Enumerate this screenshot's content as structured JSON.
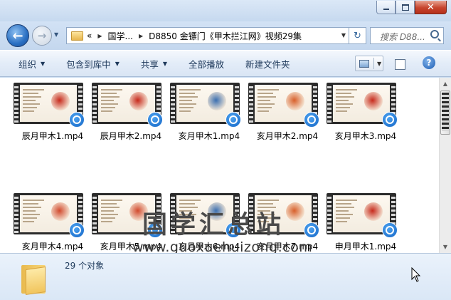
{
  "nav": {
    "back_glyph": "←",
    "forward_glyph": "→",
    "history_glyph": "▼",
    "address": {
      "prefix": "«",
      "segments": [
        "国学...",
        "D8850 金镖门《甲木拦江网》视频29集"
      ]
    },
    "refresh_glyph": "↻",
    "search_placeholder": "搜索 D88..."
  },
  "commands": {
    "organize": "组织",
    "include_in_library": "包含到库中",
    "share": "共享",
    "play_all": "全部播放",
    "new_folder": "新建文件夹",
    "help": "?"
  },
  "files": [
    {
      "name": "辰月甲木1.mp4",
      "accent": "#c72a1c"
    },
    {
      "name": "辰月甲木2.mp4",
      "accent": "#c72a1c"
    },
    {
      "name": "亥月甲木1.mp4",
      "accent": "#3b6fb0"
    },
    {
      "name": "亥月甲木2.mp4",
      "accent": "#d8602b"
    },
    {
      "name": "亥月甲木3.mp4",
      "accent": "#c72a1c"
    },
    {
      "name": "亥月甲木4.mp4",
      "accent": "#d24a2e"
    },
    {
      "name": "亥月甲木5.mp4",
      "accent": "#d24a2e"
    },
    {
      "name": "亥月甲木6.mp4",
      "accent": "#3b6fb0"
    },
    {
      "name": "亥月甲木7.mp4",
      "accent": "#d8602b"
    },
    {
      "name": "申月甲木1.mp4",
      "accent": "#c72a1c"
    }
  ],
  "watermark": {
    "title": "国学汇总站",
    "url": "www.guoxuehuizong.com"
  },
  "status": {
    "count": "29 个对象"
  },
  "colors": {
    "accent": "#1e395b",
    "close_button": "#c7442d",
    "media_badge": "#1466c6"
  }
}
